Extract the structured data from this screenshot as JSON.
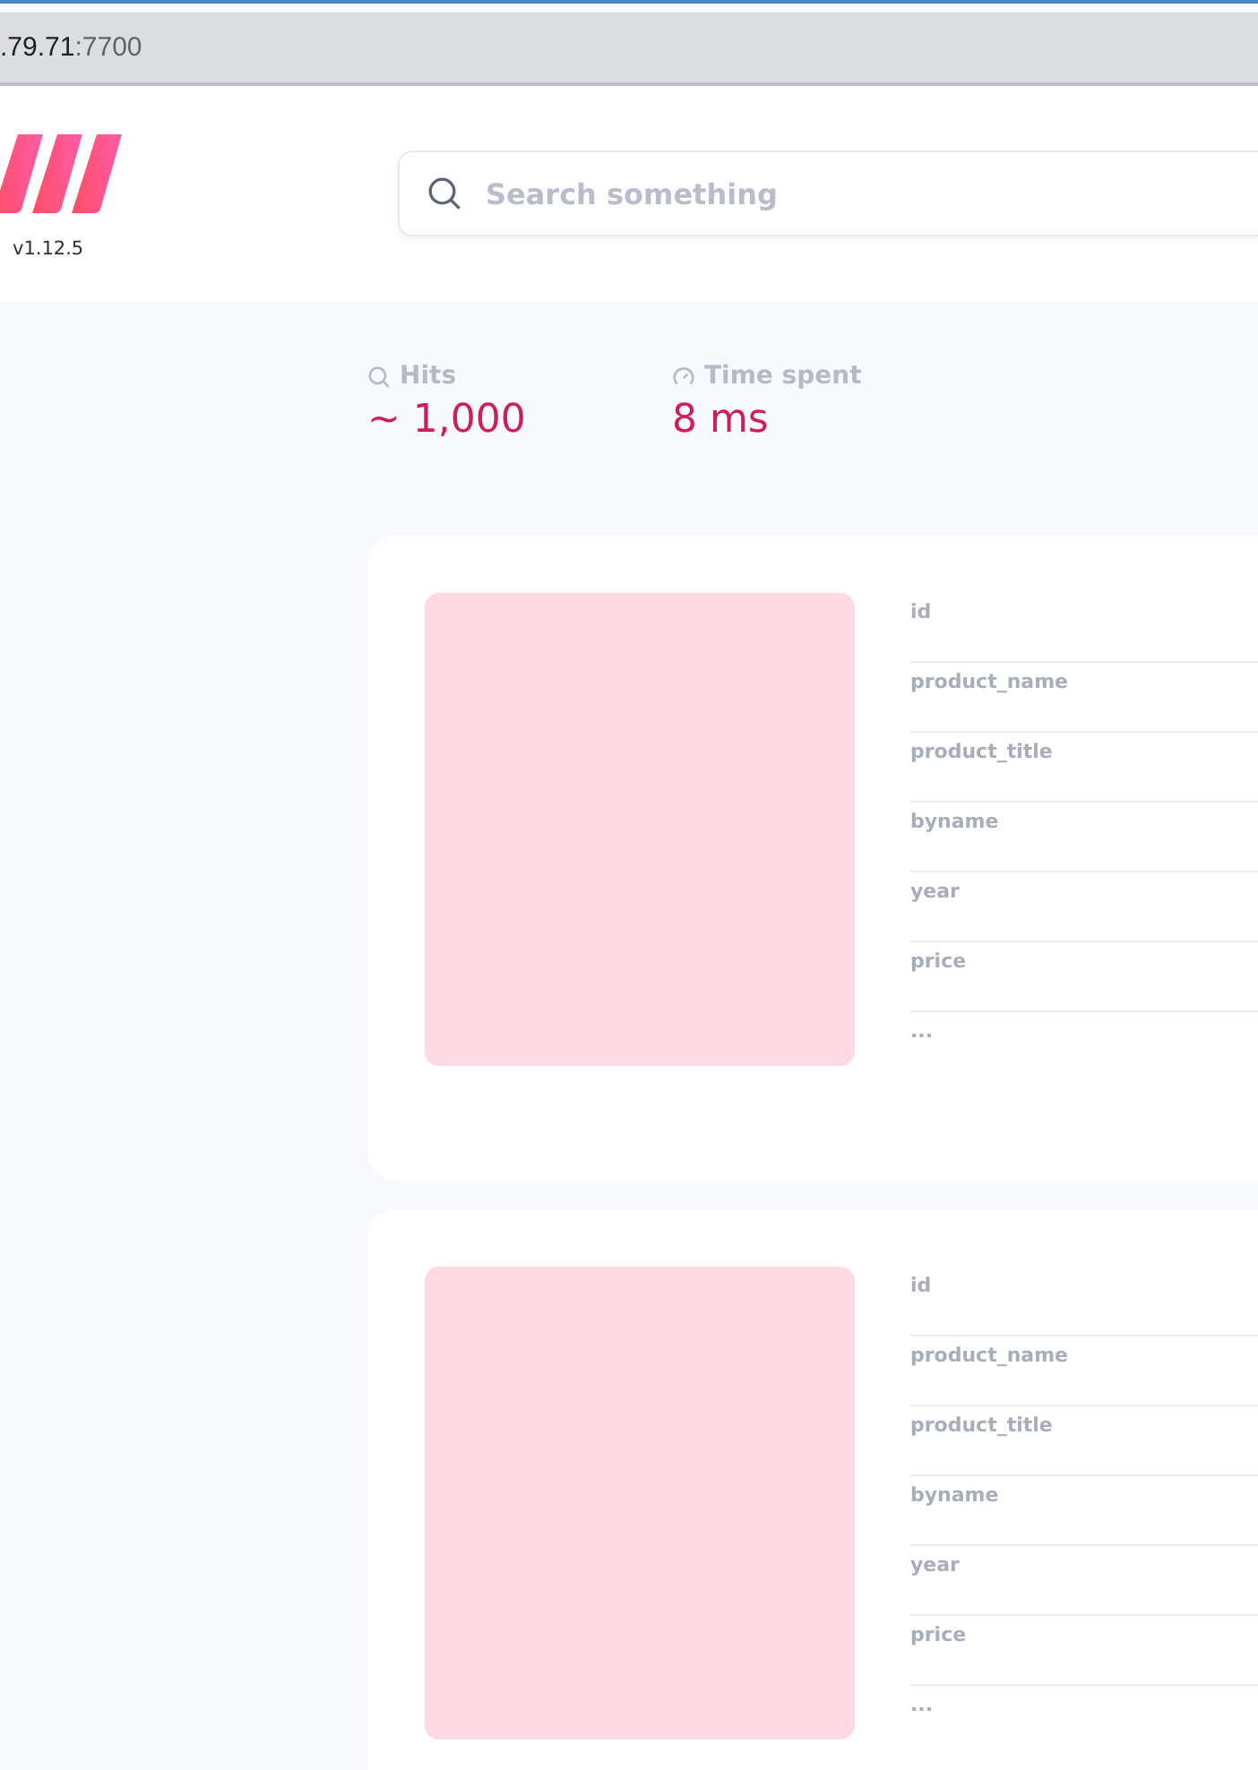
{
  "address_bar": {
    "host": ".79.71",
    "port": ":7700"
  },
  "header": {
    "version": "v1.12.5",
    "search": {
      "placeholder": "Search something"
    }
  },
  "stats": [
    {
      "kind": "hits",
      "label": "Hits",
      "value": "~ 1,000"
    },
    {
      "kind": "time",
      "label": "Time spent",
      "value": "8 ms"
    }
  ],
  "results": [
    {
      "fields": [
        "id",
        "product_name",
        "product_title",
        "byname",
        "year",
        "price",
        "..."
      ]
    },
    {
      "fields": [
        "id",
        "product_name",
        "product_title",
        "byname",
        "year",
        "price",
        "..."
      ]
    }
  ]
}
